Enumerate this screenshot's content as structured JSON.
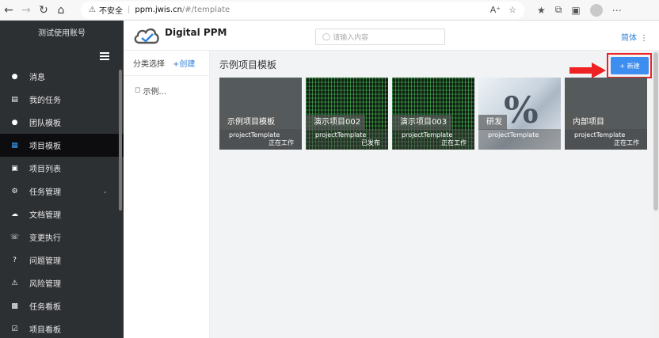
{
  "browser": {
    "security_label": "不安全",
    "host": "ppm.jwis.cn",
    "path": "/#/template"
  },
  "sidebar": {
    "account": "测试使用账号",
    "items": [
      {
        "label": "消息",
        "icon": "chat-icon"
      },
      {
        "label": "我的任务",
        "icon": "document-icon"
      },
      {
        "label": "团队模板",
        "icon": "user-icon"
      },
      {
        "label": "项目模板",
        "icon": "template-icon",
        "active": true
      },
      {
        "label": "项目列表",
        "icon": "clipboard-icon"
      },
      {
        "label": "任务管理",
        "icon": "gear-icon",
        "expandable": true
      },
      {
        "label": "文档管理",
        "icon": "cloud-upload-icon"
      },
      {
        "label": "变更执行",
        "icon": "change-icon"
      },
      {
        "label": "问题管理",
        "icon": "question-icon"
      },
      {
        "label": "风险管理",
        "icon": "risk-icon"
      },
      {
        "label": "任务看板",
        "icon": "board-icon"
      },
      {
        "label": "项目看板",
        "icon": "check-board-icon"
      }
    ]
  },
  "header": {
    "app_name": "Digital PPM",
    "search_placeholder": "请输入内容",
    "language": "简体"
  },
  "category": {
    "title": "分类选择",
    "create_label": "+创建",
    "items": [
      "示例..."
    ]
  },
  "main": {
    "title": "示例项目模板",
    "new_button": "+ 新建",
    "cards": [
      {
        "name": "示例项目模板",
        "template": "projectTemplate",
        "status": "正在工作",
        "style": "gray"
      },
      {
        "name": "演示项目002",
        "template": "projectTemplate",
        "status": "已发布",
        "style": "matrix"
      },
      {
        "name": "演示项目003",
        "template": "projectTemplate",
        "status": "正在工作",
        "style": "matrix"
      },
      {
        "name": "研发",
        "template": "projectTemplate",
        "status": "",
        "style": "photo"
      },
      {
        "name": "内部项目",
        "template": "projectTemplate",
        "status": "正在工作",
        "style": "gray"
      }
    ]
  },
  "colors": {
    "accent": "#3d8ef0",
    "sidebar_bg": "#2d3033",
    "sidebar_active_bg": "#0d0d0f",
    "highlight": "#e22222"
  }
}
